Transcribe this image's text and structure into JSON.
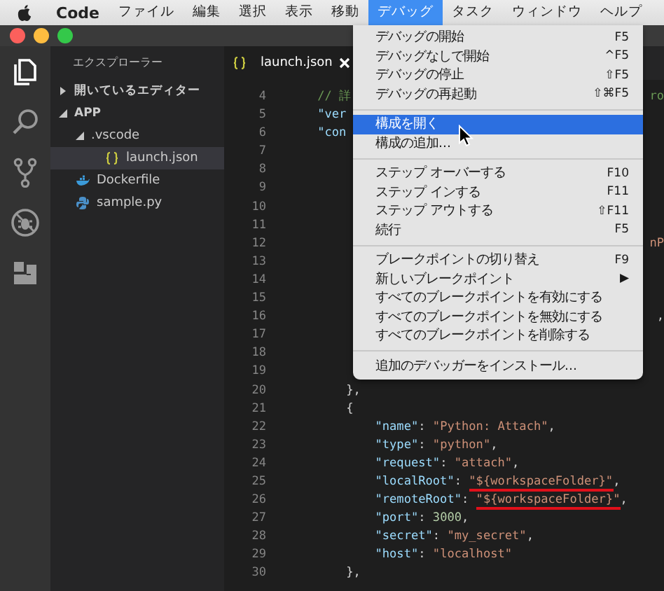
{
  "menubar": {
    "app": "Code",
    "items": [
      {
        "label": "ファイル",
        "selected": false
      },
      {
        "label": "編集",
        "selected": false
      },
      {
        "label": "選択",
        "selected": false
      },
      {
        "label": "表示",
        "selected": false
      },
      {
        "label": "移動",
        "selected": false
      },
      {
        "label": "デバッグ",
        "selected": true
      },
      {
        "label": "タスク",
        "selected": false
      },
      {
        "label": "ウィンドウ",
        "selected": false
      },
      {
        "label": "ヘルプ",
        "selected": false
      }
    ]
  },
  "sidebar": {
    "title": "エクスプローラー",
    "sections": [
      {
        "label": "開いているエディター",
        "expanded": false
      },
      {
        "label": "APP",
        "expanded": true,
        "children": [
          {
            "label": ".vscode",
            "kind": "folder",
            "expanded": true,
            "selected": false,
            "children": [
              {
                "label": "launch.json",
                "kind": "json",
                "selected": true
              }
            ]
          },
          {
            "label": "Dockerfile",
            "kind": "docker",
            "selected": false
          },
          {
            "label": "sample.py",
            "kind": "python",
            "selected": false
          }
        ]
      }
    ]
  },
  "tabs": [
    {
      "label": "launch.json",
      "kind": "json",
      "selected": true
    }
  ],
  "editor": {
    "lines": [
      {
        "number": "4",
        "tokens": [
          {
            "text": "    // 詳",
            "kind": "comment"
          }
        ],
        "right": {
          "text": "ro",
          "kind": "comment"
        }
      },
      {
        "number": "5",
        "tokens": [
          {
            "text": "    \"ver",
            "kind": "key"
          }
        ]
      },
      {
        "number": "6",
        "tokens": [
          {
            "text": "    \"con",
            "kind": "key"
          }
        ]
      },
      {
        "number": "7"
      },
      {
        "number": "8"
      },
      {
        "number": "9"
      },
      {
        "number": "10"
      },
      {
        "number": "11"
      },
      {
        "number": "12",
        "right": {
          "text": "nP",
          "kind": "string"
        }
      },
      {
        "number": "13"
      },
      {
        "number": "14"
      },
      {
        "number": "15"
      },
      {
        "number": "16",
        "right": {
          "text": ",",
          "kind": "punct"
        }
      },
      {
        "number": "17"
      },
      {
        "number": "18"
      },
      {
        "number": "19"
      },
      {
        "number": "20",
        "tokens": [
          {
            "text": "        },",
            "kind": "punct"
          }
        ]
      },
      {
        "number": "21",
        "tokens": [
          {
            "text": "        {",
            "kind": "punct"
          }
        ]
      },
      {
        "number": "22",
        "tokens": [
          {
            "text": "            \"name\"",
            "kind": "key"
          },
          {
            "text": ": ",
            "kind": "punct"
          },
          {
            "text": "\"Python: Attach\"",
            "kind": "string"
          },
          {
            "text": ",",
            "kind": "punct"
          }
        ]
      },
      {
        "number": "23",
        "tokens": [
          {
            "text": "            \"type\"",
            "kind": "key"
          },
          {
            "text": ": ",
            "kind": "punct"
          },
          {
            "text": "\"python\"",
            "kind": "string"
          },
          {
            "text": ",",
            "kind": "punct"
          }
        ]
      },
      {
        "number": "24",
        "tokens": [
          {
            "text": "            \"request\"",
            "kind": "key"
          },
          {
            "text": ": ",
            "kind": "punct"
          },
          {
            "text": "\"attach\"",
            "kind": "string"
          },
          {
            "text": ",",
            "kind": "punct"
          }
        ]
      },
      {
        "number": "25",
        "tokens": [
          {
            "text": "            \"localRoot\"",
            "kind": "key"
          },
          {
            "text": ": ",
            "kind": "punct"
          },
          {
            "text": "\"${workspaceFolder}\"",
            "kind": "string",
            "underlined": true
          },
          {
            "text": ",",
            "kind": "punct"
          }
        ]
      },
      {
        "number": "26",
        "tokens": [
          {
            "text": "            \"remoteRoot\"",
            "kind": "key"
          },
          {
            "text": ": ",
            "kind": "punct"
          },
          {
            "text": "\"${workspaceFolder}\"",
            "kind": "string",
            "underlined": true
          },
          {
            "text": ",",
            "kind": "punct"
          }
        ]
      },
      {
        "number": "27",
        "tokens": [
          {
            "text": "            \"port\"",
            "kind": "key"
          },
          {
            "text": ": ",
            "kind": "punct"
          },
          {
            "text": "3000",
            "kind": "number"
          },
          {
            "text": ",",
            "kind": "punct"
          }
        ]
      },
      {
        "number": "28",
        "tokens": [
          {
            "text": "            \"secret\"",
            "kind": "key"
          },
          {
            "text": ": ",
            "kind": "punct"
          },
          {
            "text": "\"my_secret\"",
            "kind": "string"
          },
          {
            "text": ",",
            "kind": "punct"
          }
        ]
      },
      {
        "number": "29",
        "tokens": [
          {
            "text": "            \"host\"",
            "kind": "key"
          },
          {
            "text": ": ",
            "kind": "punct"
          },
          {
            "text": "\"localhost\"",
            "kind": "string"
          }
        ]
      },
      {
        "number": "30",
        "tokens": [
          {
            "text": "        },",
            "kind": "punct"
          }
        ]
      }
    ]
  },
  "menu": {
    "items": [
      {
        "kind": "item",
        "label": "デバッグの開始",
        "shortcut": "F5",
        "selected": false
      },
      {
        "kind": "item",
        "label": "デバッグなしで開始",
        "shortcut": "^F5",
        "selected": false
      },
      {
        "kind": "item",
        "label": "デバッグの停止",
        "shortcut": "⇧F5",
        "selected": false
      },
      {
        "kind": "item",
        "label": "デバッグの再起動",
        "shortcut": "⇧⌘F5",
        "selected": false
      },
      {
        "kind": "separator"
      },
      {
        "kind": "item",
        "label": "構成を開く",
        "selected": true
      },
      {
        "kind": "item",
        "label": "構成の追加...",
        "selected": false
      },
      {
        "kind": "separator"
      },
      {
        "kind": "item",
        "label": "ステップ オーバーする",
        "shortcut": "F10",
        "selected": false
      },
      {
        "kind": "item",
        "label": "ステップ インする",
        "shortcut": "F11",
        "selected": false
      },
      {
        "kind": "item",
        "label": "ステップ アウトする",
        "shortcut": "⇧F11",
        "selected": false
      },
      {
        "kind": "item",
        "label": "続行",
        "shortcut": "F5",
        "selected": false
      },
      {
        "kind": "separator"
      },
      {
        "kind": "item",
        "label": "ブレークポイントの切り替え",
        "shortcut": "F9",
        "selected": false
      },
      {
        "kind": "item",
        "label": "新しいブレークポイント",
        "shortcut": "▶",
        "selected": false
      },
      {
        "kind": "item",
        "label": "すべてのブレークポイントを有効にする",
        "selected": false
      },
      {
        "kind": "item",
        "label": "すべてのブレークポイントを無効にする",
        "selected": false
      },
      {
        "kind": "item",
        "label": "すべてのブレークポイントを削除する",
        "selected": false
      },
      {
        "kind": "separator"
      },
      {
        "kind": "item",
        "label": "追加のデバッガーをインストール...",
        "selected": false
      }
    ]
  }
}
